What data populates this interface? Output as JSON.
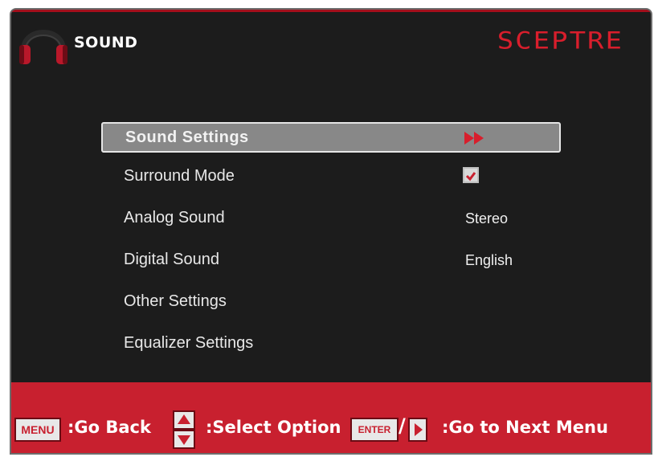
{
  "header": {
    "title": "SOUND",
    "brand": "SCEPTRE",
    "icon": "headphones-icon"
  },
  "menu": {
    "items": [
      {
        "label": "Sound Settings",
        "value": "",
        "control": "arrows",
        "selected": true
      },
      {
        "label": "Surround Mode",
        "value": "",
        "control": "checkbox",
        "checked": true
      },
      {
        "label": "Analog Sound",
        "value": "Stereo"
      },
      {
        "label": "Digital Sound",
        "value": "English"
      },
      {
        "label": "Other Settings",
        "value": ""
      },
      {
        "label": "Equalizer Settings",
        "value": ""
      }
    ]
  },
  "footer": {
    "menu_key": "MENU",
    "go_back": ":Go Back",
    "select_option": ":Select Option",
    "enter_key": "ENTER",
    "slash": "/",
    "next_menu": ":Go to Next Menu"
  },
  "colors": {
    "accent": "#c8202f",
    "brand": "#d81e2c",
    "panel": "#1c1c1c",
    "selection": "#888888"
  }
}
